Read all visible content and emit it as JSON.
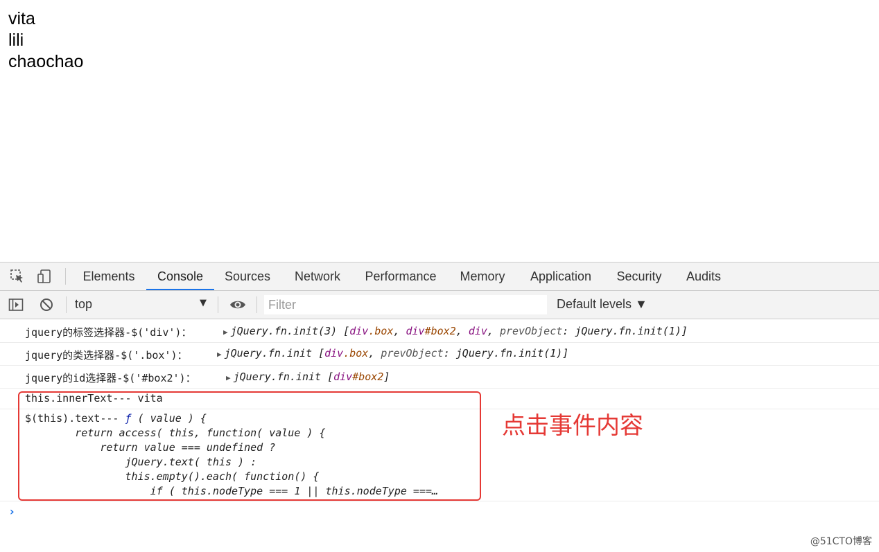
{
  "page": {
    "lines": [
      "vita",
      "lili",
      "chaochao"
    ]
  },
  "devtools": {
    "tabs": [
      "Elements",
      "Console",
      "Sources",
      "Network",
      "Performance",
      "Memory",
      "Application",
      "Security",
      "Audits"
    ],
    "active_tab": "Console",
    "context": "top",
    "filter_placeholder": "Filter",
    "levels_label": "Default levels ▼"
  },
  "console": {
    "m1_label": "jquery的标签选择器-$('div')：",
    "m1_fn": "jQuery.fn.init(3) [",
    "m1_a_tag": "div",
    "m1_a_cls": ".box",
    "m1_sep1": ", ",
    "m1_b_tag": "div",
    "m1_b_cls": "#box2",
    "m1_sep2": ", ",
    "m1_c_tag": "div",
    "m1_sep3": ", ",
    "m1_key": "prevObject",
    "m1_val": ": jQuery.fn.init(1)]",
    "m2_label": "jquery的类选择器-$('.box')：",
    "m2_fn": "jQuery.fn.init [",
    "m2_a_tag": "div",
    "m2_a_cls": ".box",
    "m2_sep": ", ",
    "m2_key": "prevObject",
    "m2_val": ": jQuery.fn.init(1)]",
    "m3_label": "jquery的id选择器-$('#box2')：",
    "m3_fn": "jQuery.fn.init [",
    "m3_a_tag": "div",
    "m3_a_cls": "#box2",
    "m3_end": "]",
    "m4_text": "this.innerText--- vita",
    "m5_prefix": "$(this).text--- ",
    "m5_f": "ƒ",
    "m5_line1": " ( value ) {",
    "m5_lines": [
      "        return access( this, function( value ) {",
      "            return value === undefined ?",
      "                jQuery.text( this ) :",
      "                this.empty().each( function() {",
      "                    if ( this.nodeType === 1 || this.nodeType ===…"
    ],
    "prompt": "›"
  },
  "annotation": "点击事件内容",
  "watermark": "@51CTO博客"
}
